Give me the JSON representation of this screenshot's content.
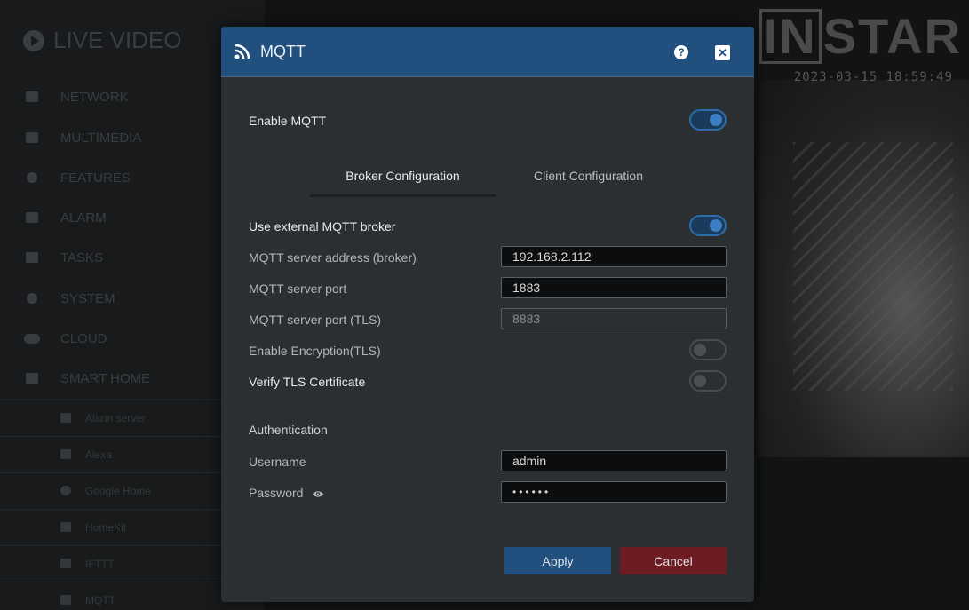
{
  "background": {
    "sidebar_title": "LIVE VIDEO",
    "sidebar_items": [
      "NETWORK",
      "MULTIMEDIA",
      "FEATURES",
      "ALARM",
      "TASKS",
      "SYSTEM",
      "CLOUD",
      "SMART HOME"
    ],
    "sidebar_sub_items": [
      "Alarm server",
      "Alexa",
      "Google Home",
      "HomeKit",
      "IFTTT",
      "MQTT"
    ],
    "logo_text_box": "IN",
    "logo_text_rest": "STAR",
    "timestamp": "2023-03-15 18:59:49"
  },
  "modal": {
    "title": "MQTT",
    "help_glyph": "?",
    "close_glyph": "✕",
    "enable_mqtt_label": "Enable MQTT",
    "enable_mqtt_on": true,
    "tabs": [
      {
        "label": "Broker Configuration",
        "active": true
      },
      {
        "label": "Client Configuration",
        "active": false
      }
    ],
    "broker": {
      "external_label": "Use external MQTT broker",
      "external_on": true,
      "server_address_label": "MQTT server address (broker)",
      "server_address_value": "192.168.2.112",
      "port_label": "MQTT server port",
      "port_value": "1883",
      "port_tls_label": "MQTT server port (TLS)",
      "port_tls_value": "8883",
      "encryption_label": "Enable Encryption(TLS)",
      "encryption_on": false,
      "verify_tls_label": "Verify TLS Certificate",
      "verify_tls_on": false
    },
    "auth": {
      "section_title": "Authentication",
      "username_label": "Username",
      "username_value": "admin",
      "password_label": "Password",
      "password_value": "••••••"
    },
    "buttons": {
      "apply": "Apply",
      "cancel": "Cancel"
    }
  },
  "colors": {
    "header": "#21507f",
    "apply_button": "#21507f",
    "cancel_button": "#6d1c22",
    "modal_bg": "#2c2f31"
  }
}
